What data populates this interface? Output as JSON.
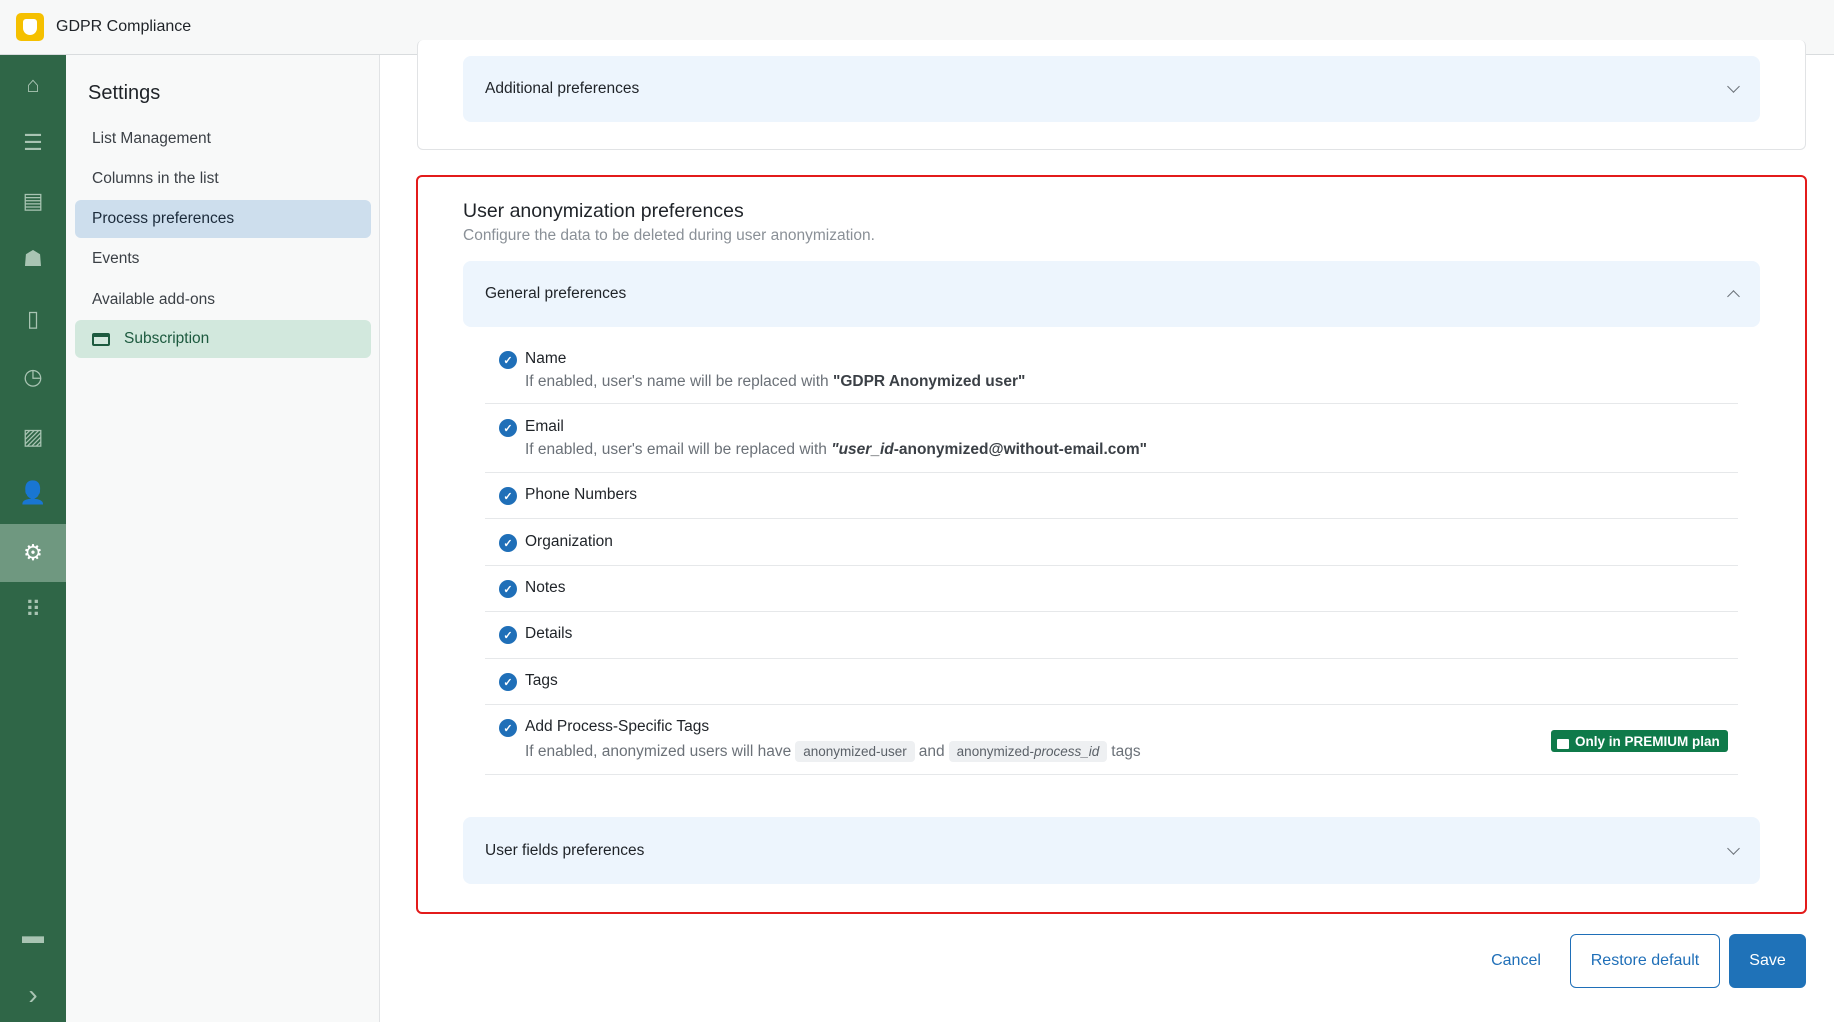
{
  "app": {
    "title": "GDPR Compliance"
  },
  "rail": {
    "items": [
      "home-icon",
      "list-icon",
      "inbox-icon",
      "contacts-icon",
      "badge-icon",
      "clock-icon",
      "chart-icon",
      "user-lock-icon",
      "gear-icon",
      "apps-icon"
    ],
    "bottom": [
      "chat-icon",
      "chevron-right-icon"
    ],
    "active": "gear-icon"
  },
  "settings": {
    "title": "Settings",
    "items": [
      {
        "label": "List Management"
      },
      {
        "label": "Columns in the list"
      },
      {
        "label": "Process preferences",
        "selected": true
      },
      {
        "label": "Events"
      },
      {
        "label": "Available add-ons"
      },
      {
        "label": "Subscription",
        "icon": "credit-card-icon"
      }
    ]
  },
  "additional": {
    "label": "Additional preferences"
  },
  "anon": {
    "title": "User anonymization preferences",
    "subtitle": "Configure the data to be deleted during user anonymization.",
    "general": {
      "label": "General preferences",
      "expanded": true
    },
    "items": [
      {
        "label": "Name",
        "checked": true,
        "desc_pre": "If enabled, user's name will be replaced with ",
        "desc_bold": "\"GDPR Anonymized user\""
      },
      {
        "label": "Email",
        "checked": true,
        "desc_pre": "If enabled, user's email will be replaced with ",
        "desc_bold_i": "\"user_id",
        "desc_bold": "-anonymized@without-email.com\""
      },
      {
        "label": "Phone Numbers",
        "checked": true
      },
      {
        "label": "Organization",
        "checked": true
      },
      {
        "label": "Notes",
        "checked": true
      },
      {
        "label": "Details",
        "checked": true
      },
      {
        "label": "Tags",
        "checked": true
      },
      {
        "label": "Add Process-Specific Tags",
        "checked": true,
        "desc_pre": "If enabled, anonymized users will have",
        "tag1": "anonymized-user",
        "and": "and",
        "tag2a": "anonymized-",
        "tag2b": "process_id",
        "post": "tags"
      }
    ],
    "premium": "Only in PREMIUM plan",
    "userfields": {
      "label": "User fields preferences"
    }
  },
  "actions": {
    "cancel": "Cancel",
    "restore": "Restore default",
    "save": "Save"
  },
  "colors": {
    "rail": "#2f6647",
    "primary": "#1f6fb8",
    "premium": "#0f7a4a",
    "highlight": "#e31b1b"
  }
}
